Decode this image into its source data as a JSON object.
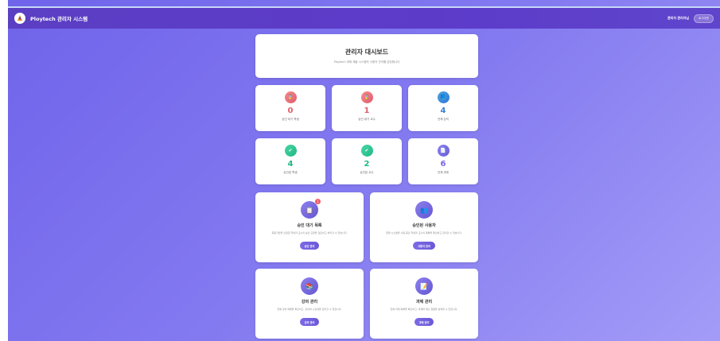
{
  "navbar": {
    "brand": "Ploytech 관리자 시스템",
    "welcome": "관리자 관리자님",
    "logout_label": "로그아웃"
  },
  "header": {
    "title": "관리자 대시보드",
    "subtitle": "Ploytech 과제 제출 시스템의 사용자 관리를 담당합니다"
  },
  "stats": [
    {
      "icon": "pending-user-icon",
      "glyph": "⌛",
      "value": "0",
      "label": "승인 대기 학생",
      "color": "red"
    },
    {
      "icon": "pending-teacher-icon",
      "glyph": "⌛",
      "value": "1",
      "label": "승인 대기 교수",
      "color": "red"
    },
    {
      "icon": "book-icon",
      "glyph": "📘",
      "value": "4",
      "label": "전체 강의",
      "color": "blue"
    },
    {
      "icon": "check-icon",
      "glyph": "✔",
      "value": "4",
      "label": "승인된 학생",
      "color": "green"
    },
    {
      "icon": "check-icon",
      "glyph": "✔",
      "value": "2",
      "label": "승인된 교수",
      "color": "green"
    },
    {
      "icon": "document-icon",
      "glyph": "📄",
      "value": "6",
      "label": "전체 과제",
      "color": "purple"
    }
  ],
  "features": [
    {
      "icon": "clipboard-icon",
      "glyph": "📋",
      "badge": "1",
      "title": "승인 대기 목록",
      "desc": "회원가입을 신청한 학생과 교수의 승인 요청을 검토하고 처리할 수 있습니다.",
      "button": "승인 관리"
    },
    {
      "icon": "users-icon",
      "glyph": "👥",
      "badge": "",
      "title": "승인된 사용자",
      "desc": "현재 시스템을 사용 중인 학생과 교수의 목록을 확인하고 관리할 수 있습니다.",
      "button": "사용자 관리"
    },
    {
      "icon": "books-icon",
      "glyph": "📚",
      "badge": "",
      "title": "강의 관리",
      "desc": "전체 강의 목록을 확인하고, 강의와 수강생을 관리할 수 있습니다.",
      "button": "강의 관리"
    },
    {
      "icon": "assignment-icon",
      "glyph": "📝",
      "badge": "",
      "title": "과제 관리",
      "desc": "전체 과제 목록을 확인하고, 과제와 제출 현황을 살펴볼 수 있습니다.",
      "button": "과제 관리"
    }
  ]
}
